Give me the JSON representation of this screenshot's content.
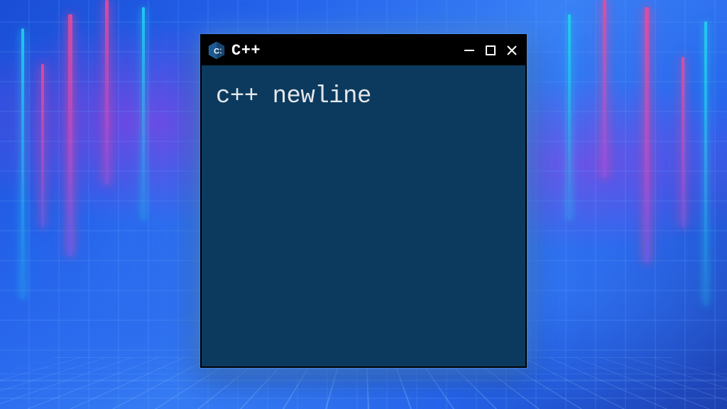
{
  "window": {
    "title": "C++",
    "icon": "cpp-logo-icon"
  },
  "content": {
    "text": "c++ newline"
  },
  "controls": {
    "minimize": "minimize-icon",
    "maximize": "maximize-icon",
    "close": "close-icon"
  },
  "colors": {
    "window_bg": "#0b3a5e",
    "titlebar_bg": "#000000",
    "text": "#e5e7eb",
    "glow": "#3b82f6"
  }
}
